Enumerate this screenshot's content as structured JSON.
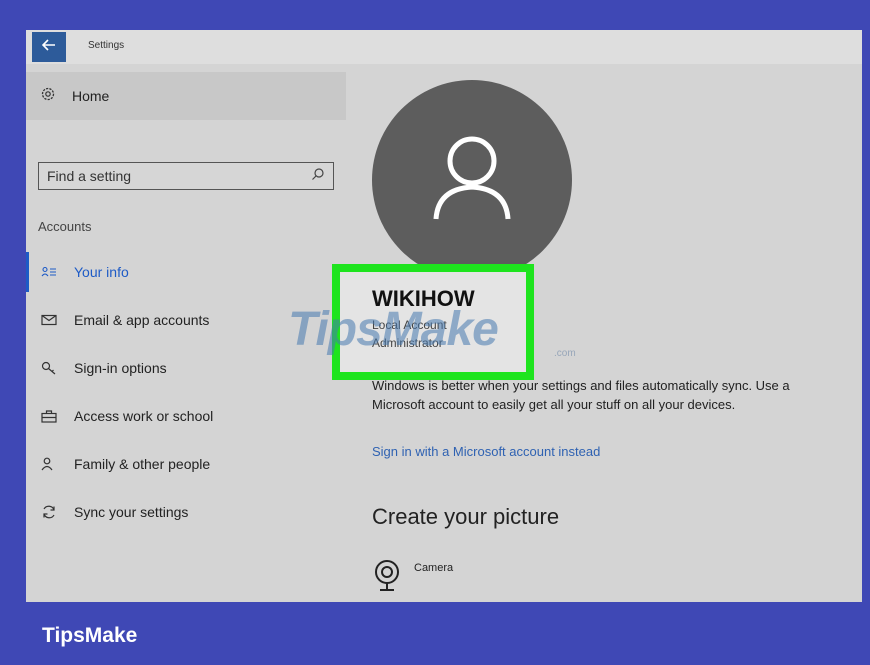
{
  "window": {
    "title": "Settings",
    "back_icon": "back-arrow-icon"
  },
  "sidebar": {
    "home_label": "Home",
    "home_icon": "gear-icon",
    "search_placeholder": "Find a setting",
    "search_icon": "search-icon",
    "section_heading": "Accounts",
    "items": [
      {
        "label": "Your info",
        "icon": "person-card-icon",
        "active": true
      },
      {
        "label": "Email & app accounts",
        "icon": "mail-icon",
        "active": false
      },
      {
        "label": "Sign-in options",
        "icon": "key-icon",
        "active": false
      },
      {
        "label": "Access work or school",
        "icon": "briefcase-icon",
        "active": false
      },
      {
        "label": "Family & other people",
        "icon": "person-add-icon",
        "active": false
      },
      {
        "label": "Sync your settings",
        "icon": "sync-icon",
        "active": false
      }
    ]
  },
  "main": {
    "avatar_icon": "user-avatar-icon",
    "username": "WIKIHOW",
    "account_type": "Local Account",
    "account_role": "Administrator",
    "sync_message": "Windows is better when your settings and files automatically sync. Use a Microsoft account to easily get all your stuff on all your devices.",
    "ms_link": "Sign in with a Microsoft account instead",
    "picture_heading": "Create your picture",
    "camera_label": "Camera",
    "camera_icon": "camera-icon"
  },
  "overlay": {
    "watermark": "TipsMake",
    "watermark_sub": ".com",
    "highlight_color": "#1ee41e"
  },
  "footer": {
    "brand": "TipsMake"
  },
  "colors": {
    "background": "#3f48b5",
    "accent": "#1e5bc6",
    "link": "#2f62b2"
  }
}
